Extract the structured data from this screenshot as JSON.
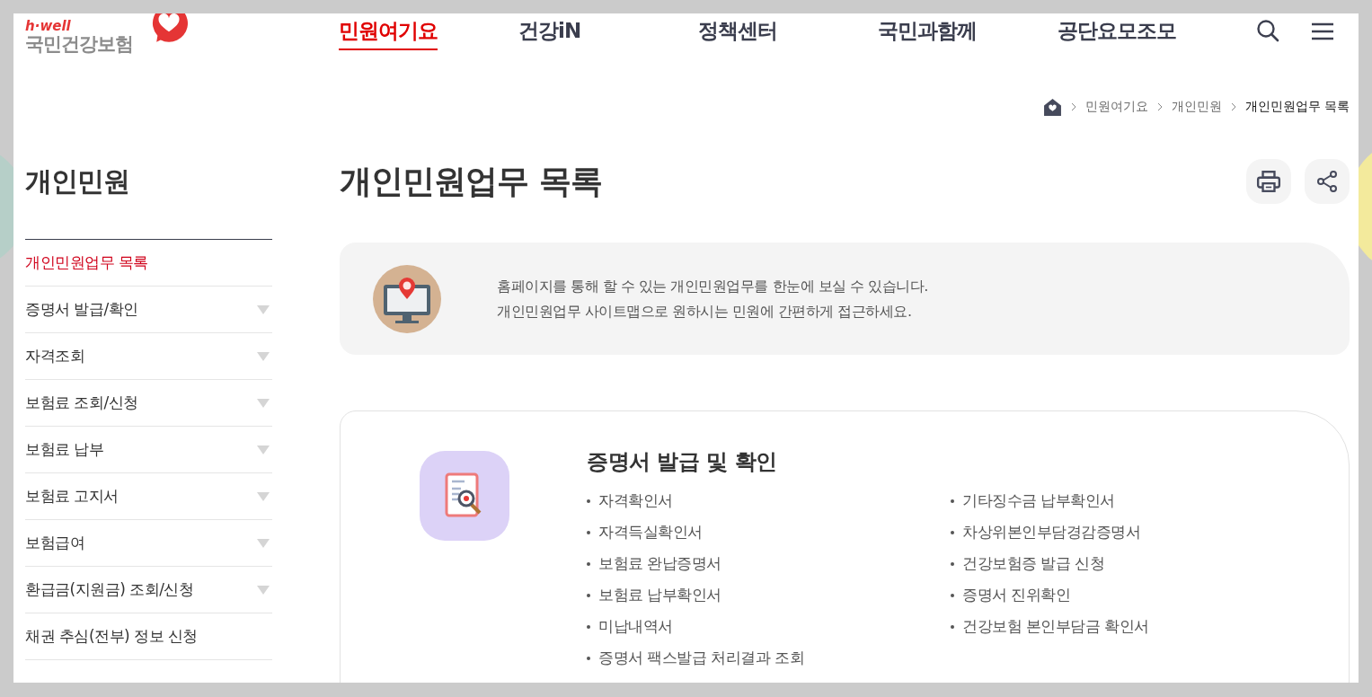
{
  "logo": {
    "tagline": "h·well",
    "name": "국민건강보험"
  },
  "nav": [
    {
      "label": "민원여기요",
      "selected": true
    },
    {
      "label": "건강iN",
      "selected": false
    },
    {
      "label": "정책센터",
      "selected": false
    },
    {
      "label": "국민과함께",
      "selected": false
    },
    {
      "label": "공단요모조모",
      "selected": false
    }
  ],
  "breadcrumb": [
    "민원여기요",
    "개인민원",
    "개인민원업무 목록"
  ],
  "sidebar": {
    "title": "개인민원",
    "items": [
      {
        "label": "개인민원업무 목록",
        "selected": true,
        "expandable": false
      },
      {
        "label": "증명서 발급/확인",
        "selected": false,
        "expandable": true
      },
      {
        "label": "자격조회",
        "selected": false,
        "expandable": true
      },
      {
        "label": "보험료 조회/신청",
        "selected": false,
        "expandable": true
      },
      {
        "label": "보험료 납부",
        "selected": false,
        "expandable": true
      },
      {
        "label": "보험료 고지서",
        "selected": false,
        "expandable": true
      },
      {
        "label": "보험급여",
        "selected": false,
        "expandable": true
      },
      {
        "label": "환급금(지원금) 조회/신청",
        "selected": false,
        "expandable": true
      },
      {
        "label": "채권 추심(전부) 정보 신청",
        "selected": false,
        "expandable": false
      }
    ]
  },
  "page_title": "개인민원업무 목록",
  "info": [
    "홈페이지를 통해 할 수 있는 개인민원업무를 한눈에 보실 수 있습니다.",
    "개인민원업무 사이트맵으로 원하시는 민원에 간편하게 접근하세요."
  ],
  "section": {
    "title": "증명서 발급 및 확인",
    "columns": [
      [
        "자격확인서",
        "자격득실확인서",
        "보험료 완납증명서",
        "보험료 납부확인서",
        "미납내역서",
        "증명서 팩스발급 처리결과 조회"
      ],
      [
        "기타징수금 납부확인서",
        "차상위본인부담경감증명서",
        "건강보험증 발급 신청",
        "증명서 진위확인",
        "건강보험 본인부담금 확인서"
      ]
    ]
  }
}
